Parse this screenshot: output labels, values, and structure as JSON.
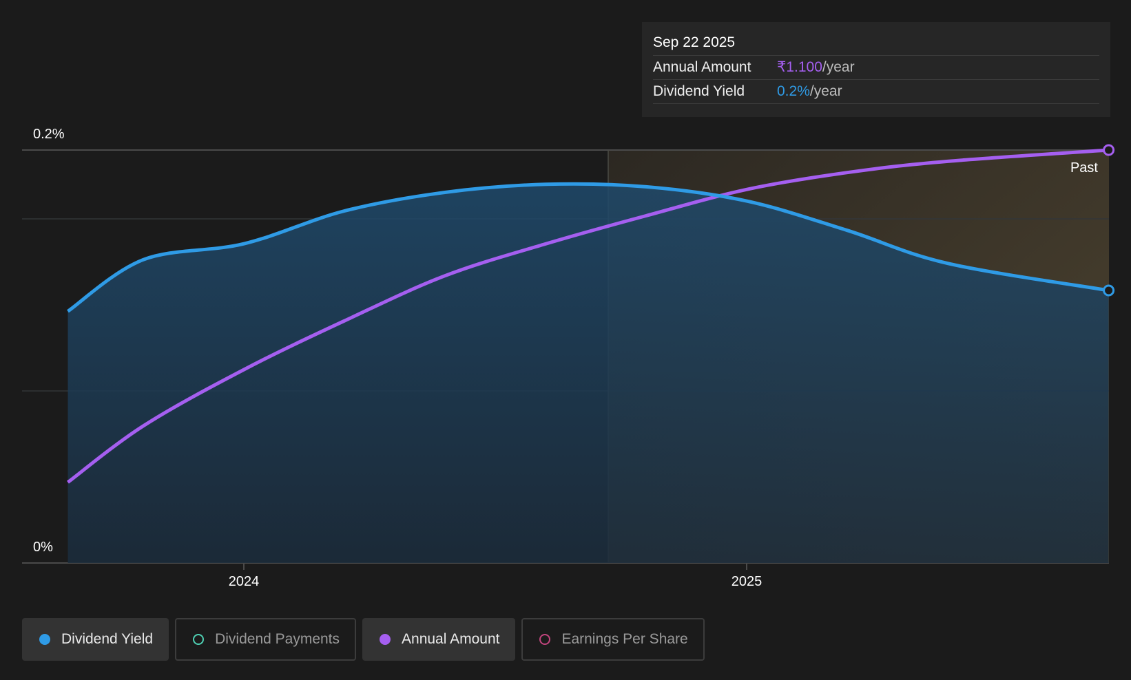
{
  "tooltip": {
    "date": "Sep 22 2025",
    "rows": [
      {
        "label": "Annual Amount",
        "value": "₹1.100",
        "suffix": "/year"
      },
      {
        "label": "Dividend Yield",
        "value": "0.2%",
        "suffix": "/year"
      }
    ]
  },
  "legend": [
    {
      "label": "Dividend Yield",
      "active": true,
      "color": "#2f9be6"
    },
    {
      "label": "Dividend Payments",
      "active": false,
      "color": "#4fd1b4"
    },
    {
      "label": "Annual Amount",
      "active": true,
      "color": "#a55ff0"
    },
    {
      "label": "Earnings Per Share",
      "active": false,
      "color": "#c2457e"
    }
  ],
  "chart_data": {
    "type": "area",
    "y_tick_labels": [
      "0.2%",
      "0%"
    ],
    "x_tick_labels": [
      "2024",
      "2025"
    ],
    "past_label": "Past",
    "series": [
      {
        "name": "Dividend Yield",
        "color": "#2f9be6",
        "y_range": [
          "0%",
          "0.2%"
        ],
        "points": [
          [
            2023.65,
            0.1219
          ],
          [
            2023.8,
            0.1469
          ],
          [
            2024.0,
            0.1546
          ],
          [
            2024.2,
            0.1705
          ],
          [
            2024.4,
            0.1795
          ],
          [
            2024.6,
            0.1834
          ],
          [
            2024.8,
            0.1822
          ],
          [
            2025.0,
            0.1753
          ],
          [
            2025.2,
            0.1611
          ],
          [
            2025.4,
            0.1451
          ],
          [
            2025.72,
            0.132
          ]
        ]
      },
      {
        "name": "Annual Amount",
        "color": "#a55ff0",
        "y_range": [
          "₹0",
          "₹1.100"
        ],
        "points": [
          [
            2023.65,
            0.215
          ],
          [
            2023.8,
            0.365
          ],
          [
            2024.0,
            0.515
          ],
          [
            2024.2,
            0.645
          ],
          [
            2024.4,
            0.765
          ],
          [
            2024.6,
            0.85
          ],
          [
            2024.8,
            0.925
          ],
          [
            2025.0,
            0.995
          ],
          [
            2025.2,
            1.04
          ],
          [
            2025.4,
            1.07
          ],
          [
            2025.72,
            1.1
          ]
        ]
      }
    ],
    "grid": true,
    "highlight_region": "past"
  }
}
